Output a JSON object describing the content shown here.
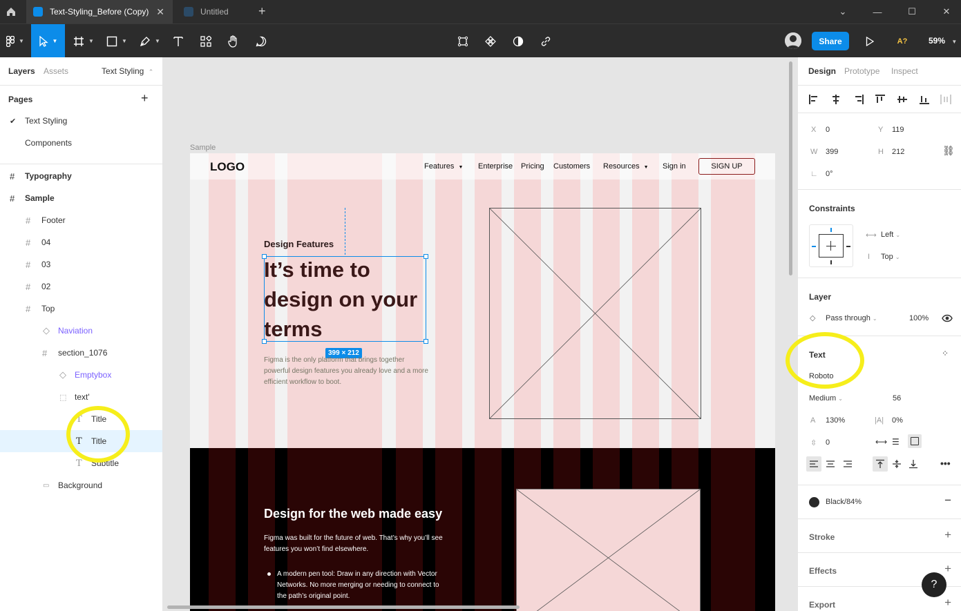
{
  "titlebar": {
    "active_tab": "Text-Styling_Before (Copy)",
    "inactive_tab": "Untitled"
  },
  "toolbar": {
    "share_label": "Share",
    "missing_fonts": "A?",
    "zoom": "59%"
  },
  "left_panel": {
    "tabs": [
      "Layers",
      "Assets"
    ],
    "page_selector": "Text Styling",
    "pages_heading": "Pages",
    "pages": [
      "Text Styling",
      "Components"
    ],
    "layers": {
      "typography": "Typography",
      "sample": "Sample",
      "footer": "Footer",
      "f04": "04",
      "f03": "03",
      "f02": "02",
      "top": "Top",
      "naviation": "Naviation",
      "section": "section_1076",
      "emptybox": "Emptybox",
      "text_group": "text'",
      "title1": "Title",
      "title2": "Title",
      "subtitle": "Subtitle",
      "background": "Background"
    }
  },
  "canvas": {
    "frame_label": "Sample",
    "logo": "LOGO",
    "nav": [
      "Features",
      "Enterprise",
      "Pricing",
      "Customers",
      "Resources",
      "Sign in"
    ],
    "signup": "SIGN UP",
    "eyebrow": "Design Features",
    "headline": "It’s time to design on your terms",
    "dimension_badge": "399 × 212",
    "body": "Figma is the only platform that brings together powerful design features you already love and a more efficient workflow to boot.",
    "dark_heading": "Design for the web made easy",
    "dark_paragraph": "Figma was built for the future of web. That’s why you’ll see features you won’t find elsewhere.",
    "dark_bullet": "A modern pen tool: Draw in any direction with Vector Networks. No more merging or needing to connect to the path’s original point."
  },
  "right_panel": {
    "tabs": [
      "Design",
      "Prototype",
      "Inspect"
    ],
    "x_label": "X",
    "x_value": "0",
    "y_label": "Y",
    "y_value": "119",
    "w_label": "W",
    "w_value": "399",
    "h_label": "H",
    "h_value": "212",
    "rotation": "0°",
    "constraints_title": "Constraints",
    "constraint_h": "Left",
    "constraint_v": "Top",
    "layer_title": "Layer",
    "blend_mode": "Pass through",
    "opacity": "100%",
    "text_title": "Text",
    "font_family": "Roboto",
    "font_weight": "Medium",
    "font_size": "56",
    "line_height": "130%",
    "letter_spacing": "0%",
    "paragraph_spacing": "0",
    "fill_name": "Black/84%",
    "stroke_title": "Stroke",
    "effects_title": "Effects",
    "export_title": "Export",
    "help": "?"
  },
  "colors": {
    "accent": "#0c8ce9",
    "highlight": "#f6ee1b",
    "component_purple": "#7b61ff",
    "column_pink": "#f5d7d7",
    "dark_band": "#000000"
  }
}
